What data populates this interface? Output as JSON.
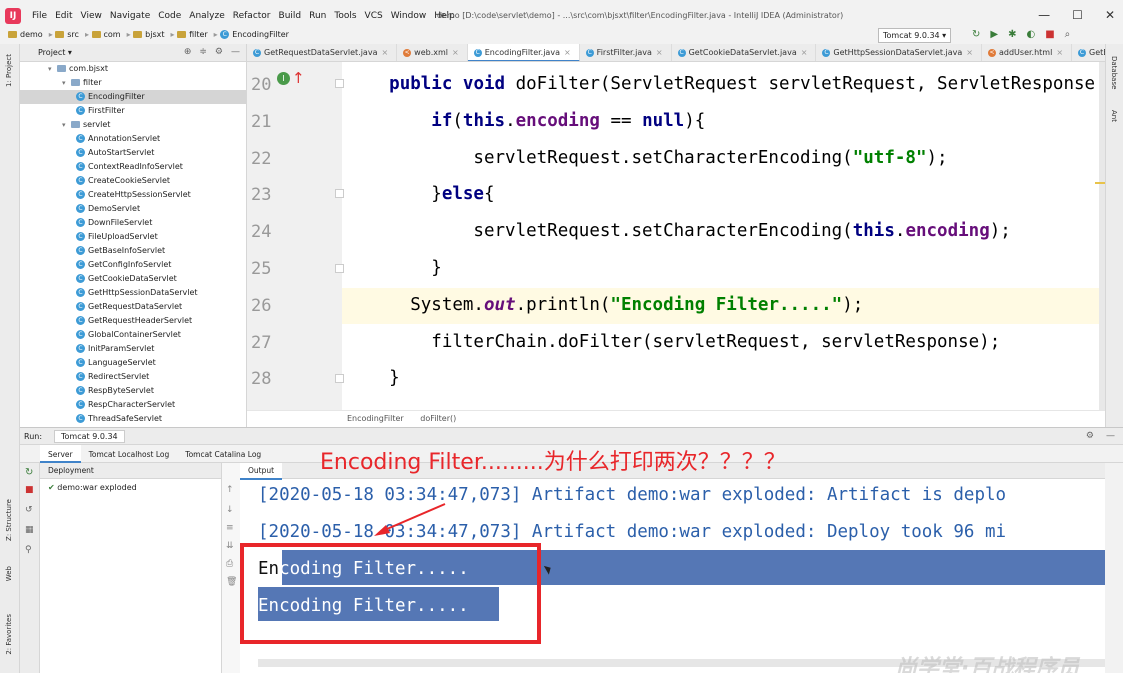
{
  "menubar": {
    "items": [
      "File",
      "Edit",
      "View",
      "Navigate",
      "Code",
      "Analyze",
      "Refactor",
      "Build",
      "Run",
      "Tools",
      "VCS",
      "Window",
      "Help"
    ],
    "window_title": "demo [D:\\code\\servlet\\demo] - ...\\src\\com\\bjsxt\\filter\\EncodingFilter.java - IntelliJ IDEA (Administrator)"
  },
  "navbar": {
    "crumbs": [
      "demo",
      "src",
      "com",
      "bjsxt",
      "filter",
      "EncodingFilter"
    ],
    "run_config": "Tomcat 9.0.34"
  },
  "left_stripe": {
    "project": "1: Project",
    "structure": "Z: Structure",
    "web": "Web",
    "favorites": "2: Favorites"
  },
  "right_stripe": {
    "database": "Database",
    "ant": "Ant"
  },
  "project_panel": {
    "title": "Project",
    "tree": [
      {
        "label": "com.bjsxt",
        "type": "folder",
        "depth": 1
      },
      {
        "label": "filter",
        "type": "folder",
        "depth": 2
      },
      {
        "label": "EncodingFilter",
        "type": "class",
        "depth": 3,
        "selected": true
      },
      {
        "label": "FirstFilter",
        "type": "class",
        "depth": 3
      },
      {
        "label": "servlet",
        "type": "folder",
        "depth": 2
      },
      {
        "label": "AnnotationServlet",
        "type": "class",
        "depth": 3
      },
      {
        "label": "AutoStartServlet",
        "type": "class",
        "depth": 3
      },
      {
        "label": "ContextReadInfoServlet",
        "type": "class",
        "depth": 3
      },
      {
        "label": "CreateCookieServlet",
        "type": "class",
        "depth": 3
      },
      {
        "label": "CreateHttpSessionServlet",
        "type": "class",
        "depth": 3
      },
      {
        "label": "DemoServlet",
        "type": "class",
        "depth": 3
      },
      {
        "label": "DownFileServlet",
        "type": "class",
        "depth": 3
      },
      {
        "label": "FileUploadServlet",
        "type": "class",
        "depth": 3
      },
      {
        "label": "GetBaseInfoServlet",
        "type": "class",
        "depth": 3
      },
      {
        "label": "GetConfigInfoServlet",
        "type": "class",
        "depth": 3
      },
      {
        "label": "GetCookieDataServlet",
        "type": "class",
        "depth": 3
      },
      {
        "label": "GetHttpSessionDataServlet",
        "type": "class",
        "depth": 3
      },
      {
        "label": "GetRequestDataServlet",
        "type": "class",
        "depth": 3
      },
      {
        "label": "GetRequestHeaderServlet",
        "type": "class",
        "depth": 3
      },
      {
        "label": "GlobalContainerServlet",
        "type": "class",
        "depth": 3
      },
      {
        "label": "InitParamServlet",
        "type": "class",
        "depth": 3
      },
      {
        "label": "LanguageServlet",
        "type": "class",
        "depth": 3
      },
      {
        "label": "RedirectServlet",
        "type": "class",
        "depth": 3
      },
      {
        "label": "RespByteServlet",
        "type": "class",
        "depth": 3
      },
      {
        "label": "RespCharacterServlet",
        "type": "class",
        "depth": 3
      },
      {
        "label": "ThreadSafeServlet",
        "type": "class",
        "depth": 3
      }
    ]
  },
  "editor_tabs": [
    {
      "label": "GetRequestDataServlet.java",
      "active": false
    },
    {
      "label": "web.xml",
      "active": false
    },
    {
      "label": "EncodingFilter.java",
      "active": true
    },
    {
      "label": "FirstFilter.java",
      "active": false
    },
    {
      "label": "GetCookieDataServlet.java",
      "active": false
    },
    {
      "label": "GetHttpSessionDataServlet.java",
      "active": false
    },
    {
      "label": "addUser.html",
      "active": false
    },
    {
      "label": "GetBaseInfoS",
      "active": false
    }
  ],
  "editor": {
    "line_numbers": [
      "20",
      "21",
      "22",
      "23",
      "24",
      "25",
      "26",
      "27",
      "28"
    ],
    "breadcrumb": [
      "EncodingFilter",
      "doFilter()"
    ]
  },
  "run_panel": {
    "label": "Run:",
    "config": "Tomcat 9.0.34",
    "tabs": [
      "Server",
      "Tomcat Localhost Log",
      "Tomcat Catalina Log"
    ],
    "deployment_header": "Deployment",
    "deployment_item": "demo:war exploded",
    "output_header": "Output",
    "log_lines": [
      "[2020-05-18 03:34:47,073] Artifact demo:war exploded: Artifact is deplo",
      "[2020-05-18 03:34:47,073] Artifact demo:war exploded: Deploy took 96 mi"
    ],
    "printed_lines": [
      "Encoding Filter.....",
      "Encoding Filter....."
    ]
  },
  "annotation": {
    "text": "Encoding Filter.........为什么打印两次？？？？"
  },
  "colors": {
    "accent": "#4083c9",
    "annotation_red": "#e8262a",
    "selection": "#5577b5"
  }
}
